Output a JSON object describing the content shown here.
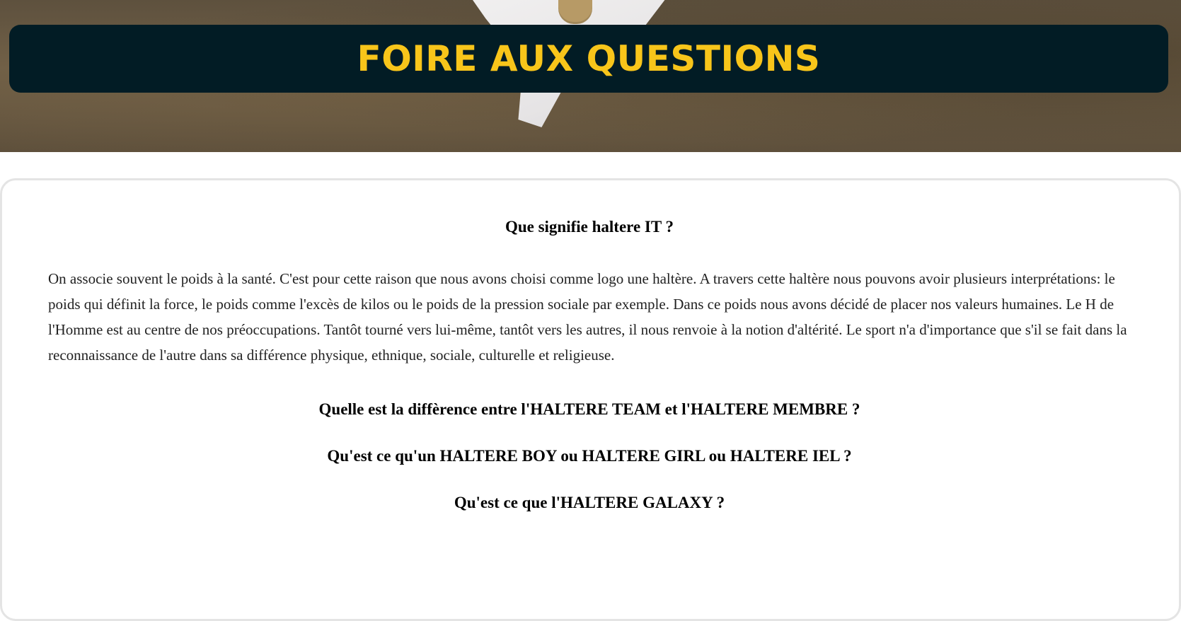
{
  "hero": {
    "title": "FOIRE AUX QUESTIONS"
  },
  "faq": [
    {
      "question": "Que signifie haltere IT ?",
      "answer": "On associe souvent le poids à la santé. C'est pour cette raison que nous avons choisi comme logo une haltère. A travers cette haltère nous pouvons avoir plusieurs interprétations: le poids qui définit la force, le poids comme l'excès de kilos ou le poids de la pression sociale par exemple. Dans ce poids nous avons décidé de placer nos valeurs humaines. Le H de l'Homme est au centre de nos préoccupations. Tantôt tourné vers lui-même, tantôt vers les autres, il nous renvoie à la notion d'altérité. Le sport n'a d'importance que s'il se fait dans la reconnaissance de l'autre dans sa différence physique, ethnique, sociale, culturelle et religieuse."
    },
    {
      "question": "Quelle est la diffèrence entre l'HALTERE TEAM et l'HALTERE MEMBRE ?"
    },
    {
      "question": "Qu'est ce qu'un HALTERE BOY ou HALTERE GIRL ou HALTERE IEL ?"
    },
    {
      "question": "Qu'est ce que l'HALTERE GALAXY ?"
    }
  ],
  "colors": {
    "banner_bg": "#021c25",
    "banner_text": "#f8c51a"
  }
}
